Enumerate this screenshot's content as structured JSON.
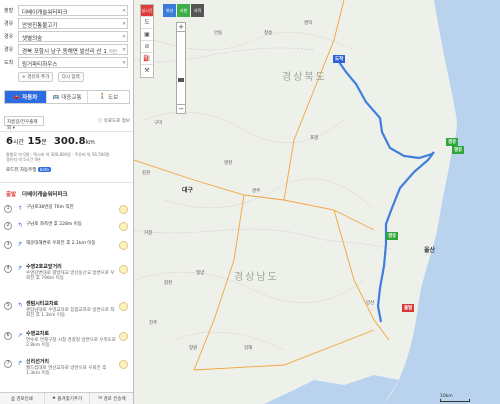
{
  "waypoints": [
    {
      "label": "출발",
      "value": "더베이캐슬워터파크",
      "tag": ""
    },
    {
      "label": "경유",
      "value": "안영진통불고기",
      "tag": ""
    },
    {
      "label": "경유",
      "value": "샛별의숲",
      "tag": ""
    },
    {
      "label": "경유",
      "value": "경북 포항시 남구 동해면 발산리 산 1",
      "tag": "지번"
    },
    {
      "label": "도착",
      "value": "링거파티하우스",
      "tag": ""
    }
  ],
  "add_actions": [
    "+ 경유지 추가",
    "다시 입력"
  ],
  "modes": [
    {
      "label": "자동차",
      "icon": "car-icon",
      "active": true
    },
    {
      "label": "대중교통",
      "icon": "bus-icon",
      "active": false
    },
    {
      "label": "도보",
      "icon": "walk-icon",
      "active": false
    }
  ],
  "route_option": "지름길/전우출제외",
  "toll_info": "유료도로 정보",
  "summary": {
    "hours": "6",
    "hours_unit": "시간",
    "minutes": "15",
    "minutes_unit": "분",
    "distance": "300.8",
    "distance_unit": "km",
    "meta_line1": "통행료 약 0원 · 택시비 약 300,800원 · 주유비 약 56,500원",
    "meta_line2": "경유지 약 5시간 0분",
    "road_label": "로드뷰 자동주행",
    "road_badge": "beta"
  },
  "start_row": {
    "tag": "출발",
    "name": "더베이캐슬워터파크"
  },
  "steps": [
    {
      "num": "1",
      "title": "",
      "text": "구남로38번길 76m 직진",
      "sub": ""
    },
    {
      "num": "2",
      "title": "",
      "text": "구남로 좌측면 후 228m 이동",
      "sub": ""
    },
    {
      "num": "3",
      "title": "",
      "text": "해운대해변로 우회전 후 2.1km 이동",
      "sub": ""
    },
    {
      "num": "4",
      "title": "수영2호교앞거리",
      "text": "수영강변대로 향방대교 방선동산교 방면으로 우회전 후 798m 이동",
      "sub": ""
    },
    {
      "num": "5",
      "title": "센텀시티교차로",
      "text": "센텀남대로 수영교차로 집합교차로 방면으로 좌회전 후 1.3km 이동",
      "sub": ""
    },
    {
      "num": "6",
      "title": "수영교차로",
      "text": "연수로 연제구청 시청 경찰청 방면으로 우측도로 2.8km 이동",
      "sub": ""
    },
    {
      "num": "7",
      "title": "신리선거리",
      "text": "월드컵대로 연산교차로 방면으로 우회전 후 1.3km 이동",
      "sub": ""
    }
  ],
  "bottom_actions": [
    "경로인쇄",
    "즐겨찾기추가",
    "경로 전송메"
  ],
  "map_tools": [
    "실시간",
    "도",
    "",
    "",
    "",
    ""
  ],
  "top_buttons": [
    {
      "label": "위성",
      "color": "#3a7ad9"
    },
    {
      "label": "지형",
      "color": "#3fae4a"
    },
    {
      "label": "지적",
      "color": "#555"
    }
  ],
  "scale_label": "10km",
  "cities": [
    {
      "name": "대구",
      "type": "city"
    },
    {
      "name": "울산",
      "type": "city"
    },
    {
      "name": "경상북도",
      "type": "prov"
    },
    {
      "name": "경상남도",
      "type": "prov"
    },
    {
      "name": "경주",
      "type": "town"
    },
    {
      "name": "영천",
      "type": "town"
    },
    {
      "name": "포항",
      "type": "town"
    },
    {
      "name": "양산",
      "type": "town"
    },
    {
      "name": "밀양",
      "type": "town"
    },
    {
      "name": "창원",
      "type": "town"
    },
    {
      "name": "김해",
      "type": "town"
    },
    {
      "name": "안동",
      "type": "town"
    },
    {
      "name": "청송",
      "type": "town"
    },
    {
      "name": "영덕",
      "type": "town"
    },
    {
      "name": "구미",
      "type": "town"
    },
    {
      "name": "김천",
      "type": "town"
    },
    {
      "name": "거창",
      "type": "town"
    },
    {
      "name": "합천",
      "type": "town"
    },
    {
      "name": "진주",
      "type": "town"
    }
  ],
  "route_flags": [
    {
      "label": "도착",
      "type": "dest"
    },
    {
      "label": "출발",
      "type": "start"
    },
    {
      "label": "경유",
      "type": "via"
    },
    {
      "label": "경유",
      "type": "via"
    },
    {
      "label": "경유",
      "type": "via"
    }
  ],
  "colors": {
    "route": "#3f7fe0",
    "sea": "#b9d3ef",
    "land": "#eef0ea",
    "accent": "#2b6de0"
  }
}
